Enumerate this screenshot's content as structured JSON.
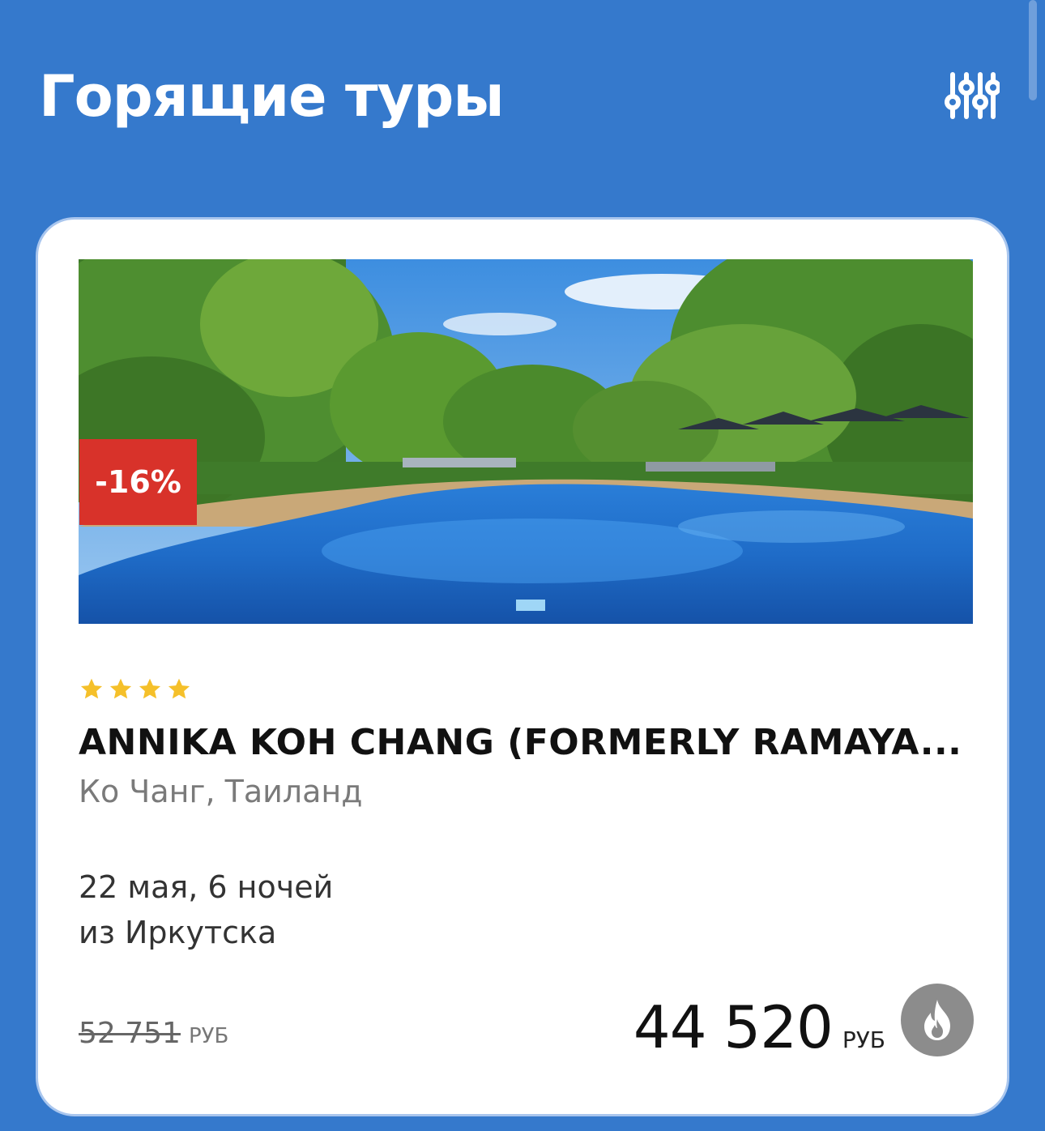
{
  "header": {
    "title": "Горящие туры",
    "filter_icon": "sliders-icon"
  },
  "tour_card": {
    "discount_badge": "-16%",
    "stars": 4,
    "star_color": "#f5c02a",
    "hotel_name": "ANNIKA KOH CHANG (FORMERLY RAMAYA...",
    "location": "Ко Чанг,  Таиланд",
    "dates": "22 мая, 6 ночей",
    "departure": "из Иркутска",
    "old_price": "52 751",
    "old_price_currency": "РУБ",
    "price": "44 520",
    "price_currency": "РУБ",
    "hot_icon": "flame-icon"
  },
  "colors": {
    "background": "#3579cc",
    "badge": "#d8322a",
    "hot_button": "#8c8c8c"
  }
}
